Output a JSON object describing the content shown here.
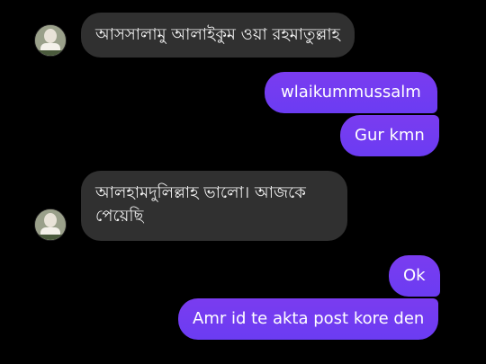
{
  "messages": [
    {
      "direction": "incoming",
      "text": "আসসালামু আলাইকুম ওয়া রহমাতুল্লাহ"
    },
    {
      "direction": "outgoing",
      "text": "wlaikummussalm"
    },
    {
      "direction": "outgoing",
      "text": "Gur kmn"
    },
    {
      "direction": "incoming",
      "text": "আলহামদুলিল্লাহ ভালো। আজকে পেয়েছি"
    },
    {
      "direction": "outgoing",
      "text": "Ok"
    },
    {
      "direction": "outgoing",
      "text": "Amr id te akta post kore den"
    }
  ],
  "colors": {
    "background": "#000000",
    "incoming_bubble": "#303030",
    "outgoing_bubble": "#6f3cf1",
    "text": "#ffffff"
  },
  "icons": {
    "avatar": "contact-avatar-photo"
  }
}
